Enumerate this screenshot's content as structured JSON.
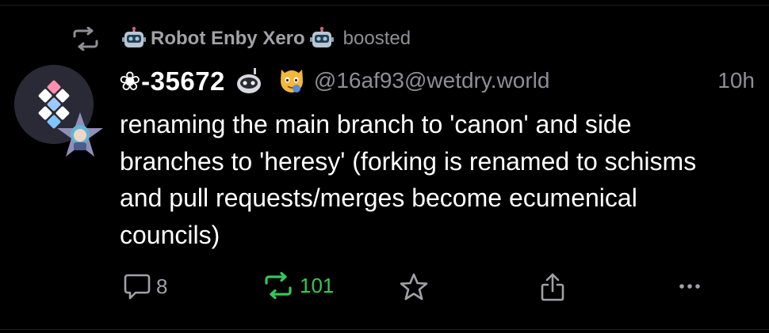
{
  "boost_header": {
    "booster_name": "Robot Enby Xero",
    "verb": "boosted"
  },
  "post": {
    "display_name": "❀-35672",
    "handle": "@16af93@wetdry.world",
    "time": "10h",
    "content": "renaming the main branch to 'canon' and side branches to 'heresy' (forking is renamed to schisms and pull requests/merges become ecumenical councils)"
  },
  "actions": {
    "reply_count": "8",
    "boost_count": "101"
  },
  "colors": {
    "background": "#000000",
    "text": "#ffffff",
    "muted": "#8e8e93",
    "boosted_green": "#34c759"
  },
  "icons": {
    "boost_header": "boost-icon",
    "reply": "reply-icon",
    "boost": "boost-icon",
    "favourite": "star-icon",
    "share": "share-icon",
    "more": "more-icon"
  }
}
